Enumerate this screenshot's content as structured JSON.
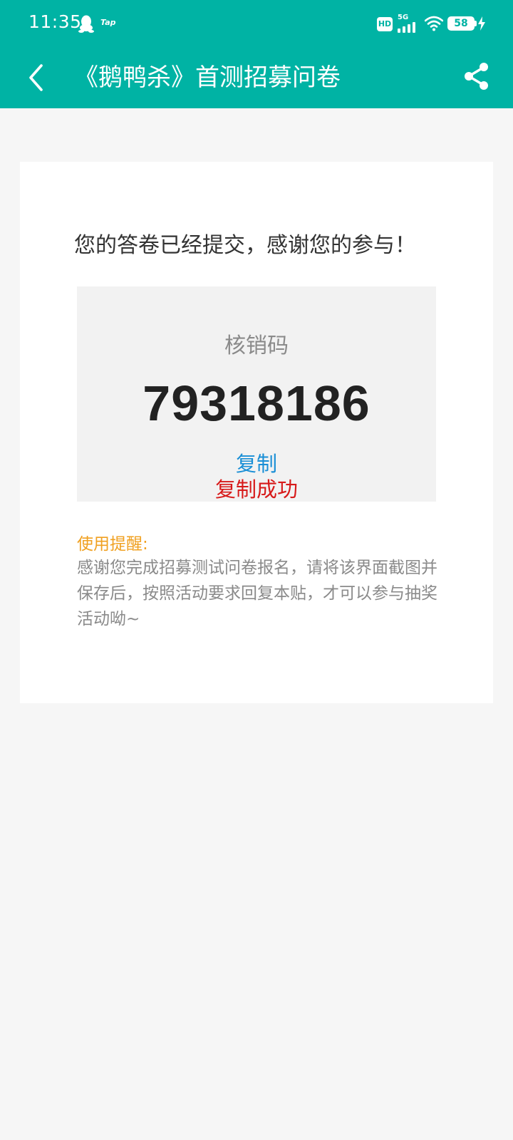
{
  "status_bar": {
    "time": "11:35",
    "notification_icons": [
      "qq-icon",
      "tap-icon"
    ],
    "tap_label": "Tap",
    "hd_label": "HD",
    "network_label": "5G",
    "battery_level": "58"
  },
  "nav": {
    "back_icon": "chevron-left-icon",
    "title": "《鹅鸭杀》首测招募问卷",
    "share_icon": "share-icon"
  },
  "main": {
    "thanks_message": "您的答卷已经提交，感谢您的参与！",
    "code_label": "核销码",
    "code_value": "79318186",
    "copy_label": "复制",
    "copy_success_label": "复制成功",
    "reminder_title": "使用提醒:",
    "reminder_body": "感谢您完成招募测试问卷报名，请将该界面截图并保存后，按照活动要求回复本贴，才可以参与抽奖活动呦~"
  },
  "colors": {
    "brand": "#00b3a4",
    "link": "#1a8fd6",
    "success": "#d71a1a",
    "reminder_title": "#f0a020",
    "page_background": "#f6f6f6"
  }
}
